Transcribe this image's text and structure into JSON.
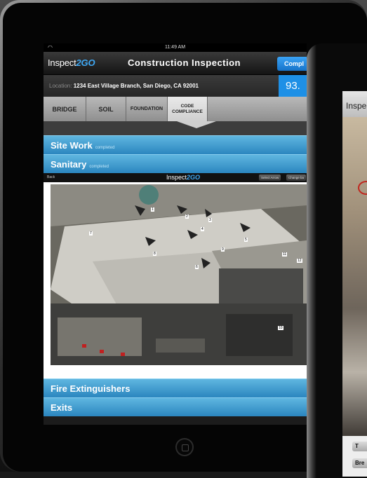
{
  "device": {
    "status_time": "11:49 AM"
  },
  "app": {
    "logo_text": "Inspect",
    "logo_go": "2GO",
    "title": "Construction Inspection",
    "complete_button": "Compl",
    "location_label": "Location:",
    "location_value": "1234 East Village Branch, San Diego, CA  92001",
    "score": "93."
  },
  "tabs": [
    {
      "label": "BRIDGE"
    },
    {
      "label": "SOIL"
    },
    {
      "label": "FOUNDATION"
    },
    {
      "label": "CODE COMPLIANCE"
    }
  ],
  "sections_top": [
    {
      "title": "Site Work",
      "status": "completed"
    },
    {
      "title": "Sanitary",
      "status": "completed"
    }
  ],
  "inner_view": {
    "back_label": "Back",
    "logo_text": "Inspect",
    "logo_go": "2GO",
    "select_arrow": "Select Arrow",
    "change_button": "Change ba",
    "markers": [
      "1",
      "2",
      "3",
      "4",
      "5",
      "6",
      "7",
      "8",
      "9",
      "10",
      "11",
      "12"
    ]
  },
  "sections_bottom": [
    {
      "title": "Fire Extinguishers"
    },
    {
      "title": "Exits"
    }
  ],
  "second_device": {
    "title": "Inspe",
    "button_top": "T",
    "button_bottom": "Bre"
  },
  "colors": {
    "accent_blue": "#1e90e6",
    "section_blue": "#3a96c9",
    "logo_blue": "#3fa9f5"
  }
}
